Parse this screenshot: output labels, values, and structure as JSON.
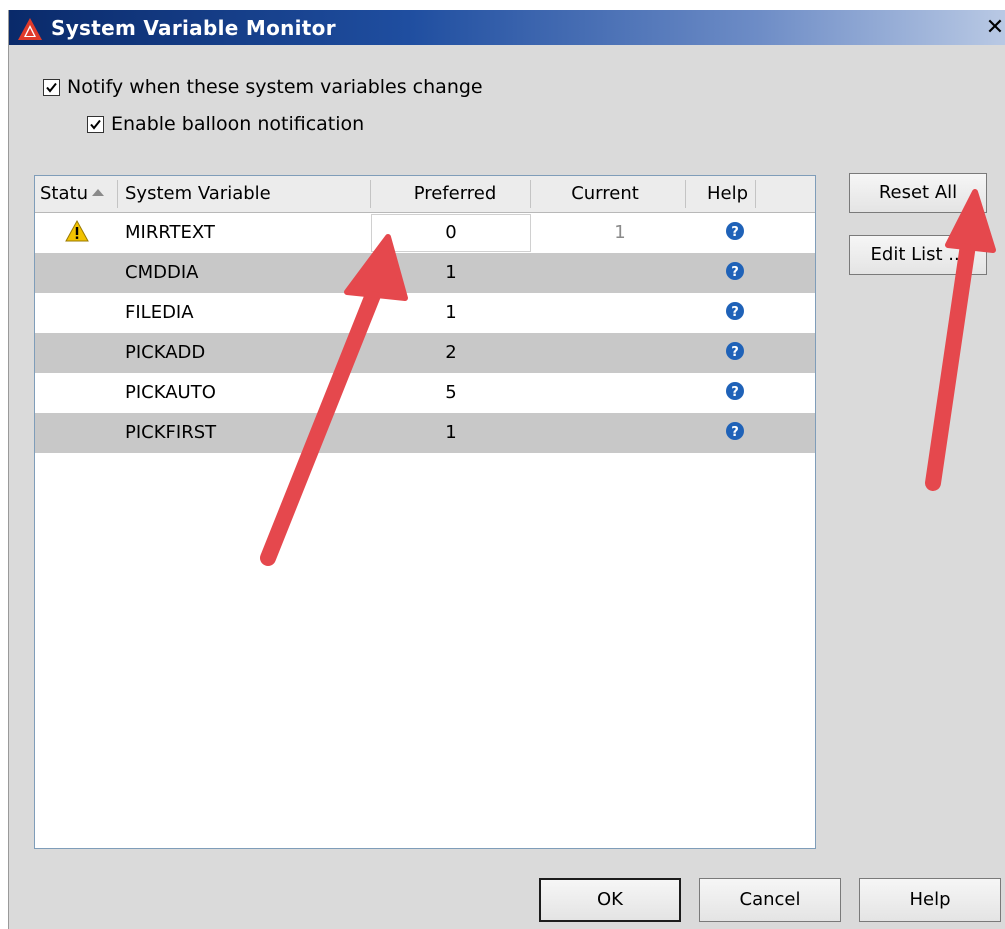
{
  "window": {
    "title": "System Variable Monitor",
    "close_glyph": "✕"
  },
  "options": {
    "notify_label": "Notify when these system variables change",
    "notify_checked": true,
    "balloon_label": "Enable balloon notification",
    "balloon_checked": true
  },
  "table": {
    "headers": {
      "status": "Statu",
      "variable": "System Variable",
      "preferred": "Preferred",
      "current": "Current",
      "help": "Help"
    },
    "rows": [
      {
        "status_icon": "warning-icon",
        "variable": "MIRRTEXT",
        "preferred": "0",
        "current": "1",
        "help_icon": "help-icon"
      },
      {
        "status_icon": "",
        "variable": "CMDDIA",
        "preferred": "1",
        "current": "",
        "help_icon": "help-icon"
      },
      {
        "status_icon": "",
        "variable": "FILEDIA",
        "preferred": "1",
        "current": "",
        "help_icon": "help-icon"
      },
      {
        "status_icon": "",
        "variable": "PICKADD",
        "preferred": "2",
        "current": "",
        "help_icon": "help-icon"
      },
      {
        "status_icon": "",
        "variable": "PICKAUTO",
        "preferred": "5",
        "current": "",
        "help_icon": "help-icon"
      },
      {
        "status_icon": "",
        "variable": "PICKFIRST",
        "preferred": "1",
        "current": "",
        "help_icon": "help-icon"
      }
    ]
  },
  "side_buttons": {
    "reset_all": "Reset All",
    "edit_list": "Edit List ..."
  },
  "footer_buttons": {
    "ok": "OK",
    "cancel": "Cancel",
    "help": "Help"
  },
  "colors": {
    "title_gradient_start": "#0a2a6a",
    "annotation_arrow": "#e5484d",
    "help_icon": "#1f62b8",
    "warning_icon": "#f2c200",
    "row_alt": "#c8c8c8"
  }
}
